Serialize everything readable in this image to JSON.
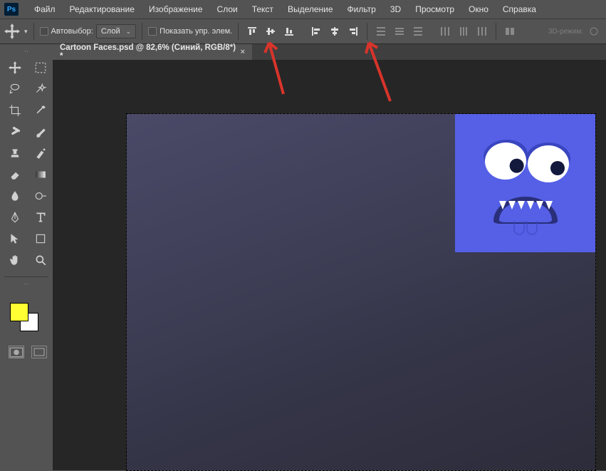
{
  "app": {
    "logo_text": "Ps"
  },
  "menu": [
    "Файл",
    "Редактирование",
    "Изображение",
    "Слои",
    "Текст",
    "Выделение",
    "Фильтр",
    "3D",
    "Просмотр",
    "Окно",
    "Справка"
  ],
  "options": {
    "auto_select_label": "Автовыбор:",
    "dropdown_value": "Слой",
    "show_controls_label": "Показать упр. элем.",
    "mode3d_label": "3D-режим:"
  },
  "document": {
    "tab_title": "Cartoon Faces.psd @ 82,6% (Синий, RGB/8*) *",
    "close_glyph": "×"
  },
  "colors": {
    "fg": "#ffff33",
    "bg": "#ffffff",
    "face": "#5560e6",
    "arrow": "#d8342b"
  }
}
